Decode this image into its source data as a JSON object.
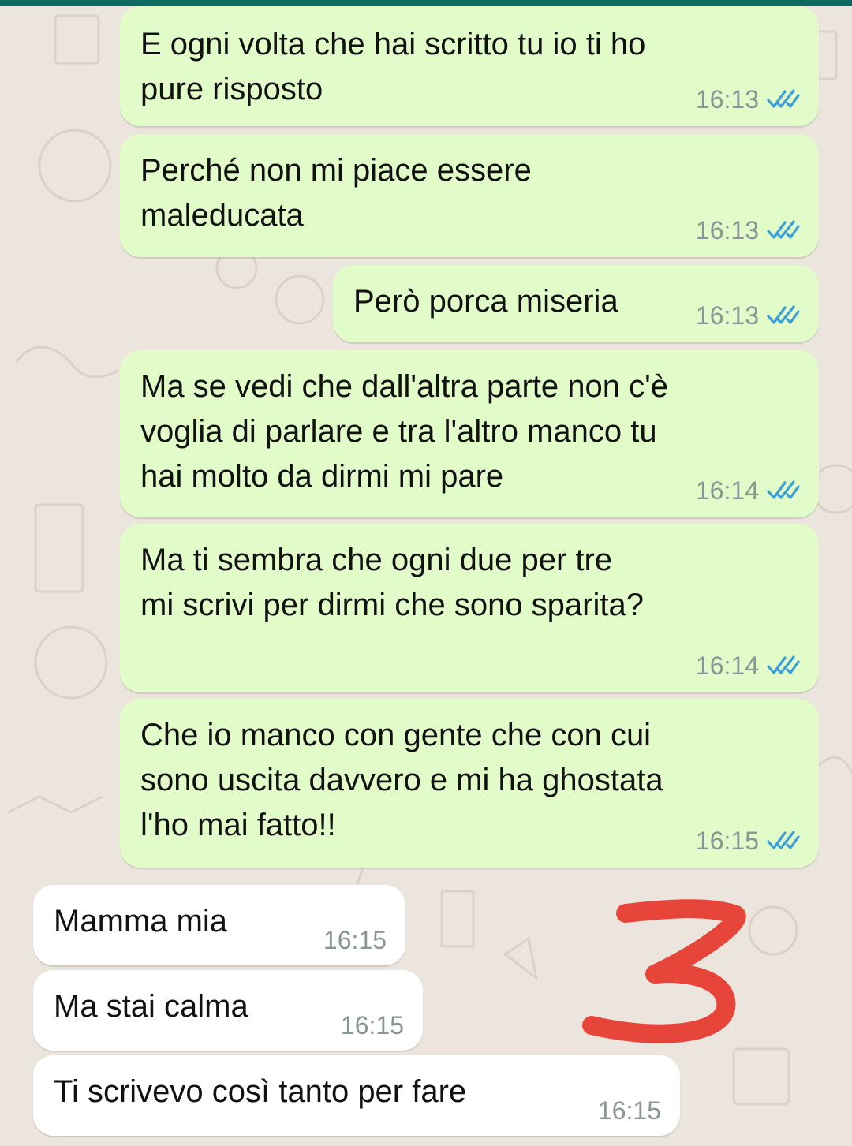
{
  "theme": {
    "outgoing_bubble": "#e2fcc9",
    "incoming_bubble": "#ffffff",
    "read_tick_color": "#3a9fd8",
    "header_strip": "#0f6b5f",
    "annotation_color": "#e8453a"
  },
  "messages": [
    {
      "direction": "outgoing",
      "text": "E ogni volta che hai scritto tu io ti ho\npure risposto",
      "time": "16:13",
      "status_icon": "double-check-read-icon"
    },
    {
      "direction": "outgoing",
      "text": "Perché non mi piace essere\nmaleducata",
      "time": "16:13",
      "status_icon": "double-check-read-icon"
    },
    {
      "direction": "outgoing",
      "text": "Però porca miseria",
      "time": "16:13",
      "status_icon": "double-check-read-icon"
    },
    {
      "direction": "outgoing",
      "text": "Ma se vedi che dall'altra parte non c'è\nvoglia di parlare e tra l'altro manco tu\nhai molto da dirmi mi pare",
      "time": "16:14",
      "status_icon": "double-check-read-icon"
    },
    {
      "direction": "outgoing",
      "text": "Ma ti sembra che ogni due per tre\nmi scrivi per dirmi che sono sparita?",
      "time": "16:14",
      "status_icon": "double-check-read-icon"
    },
    {
      "direction": "outgoing",
      "text": "Che io manco con gente che con cui\nsono uscita davvero e mi ha ghostata\nl'ho mai fatto!!",
      "time": "16:15",
      "status_icon": "double-check-read-icon"
    },
    {
      "direction": "incoming",
      "text": "Mamma mia",
      "time": "16:15"
    },
    {
      "direction": "incoming",
      "text": "Ma stai calma",
      "time": "16:15"
    },
    {
      "direction": "incoming",
      "text": "Ti scrivevo così tanto per fare",
      "time": "16:15"
    }
  ],
  "annotation": {
    "text": "3"
  }
}
